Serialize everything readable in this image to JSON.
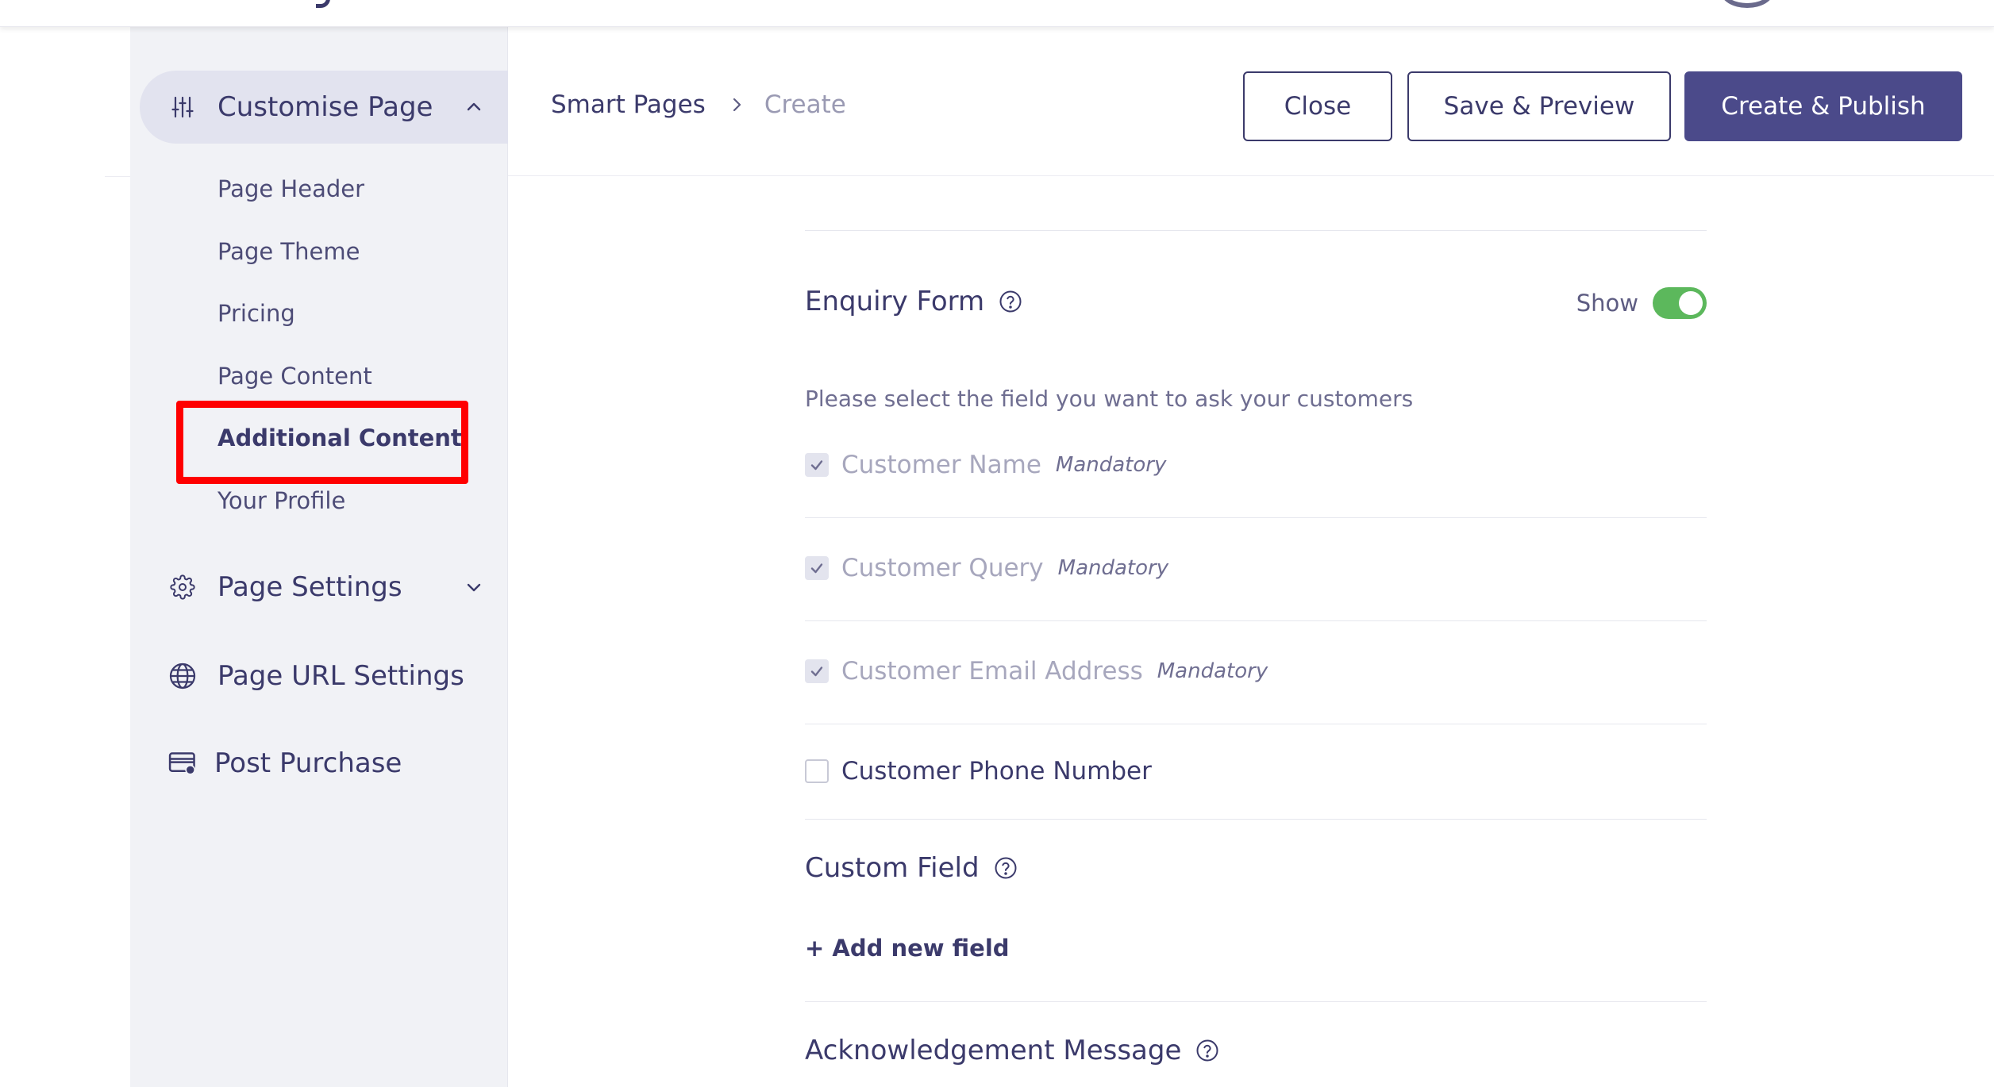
{
  "sidebar": {
    "sections": [
      {
        "label": "Customise Page",
        "icon": "sliders-icon",
        "expanded": true
      },
      {
        "label": "Page Settings",
        "icon": "gear-icon",
        "expanded": false
      },
      {
        "label": "Page URL Settings",
        "icon": "globe-icon"
      },
      {
        "label": "Post Purchase",
        "icon": "card-icon"
      }
    ],
    "sub_items": [
      {
        "label": "Page Header"
      },
      {
        "label": "Page Theme"
      },
      {
        "label": "Pricing"
      },
      {
        "label": "Page Content"
      },
      {
        "label": "Additional Content",
        "selected": true
      },
      {
        "label": "Your Profile"
      }
    ]
  },
  "header": {
    "breadcrumb": {
      "root": "Smart Pages",
      "current": "Create"
    },
    "buttons": {
      "close": "Close",
      "save_preview": "Save & Preview",
      "create_publish": "Create & Publish"
    }
  },
  "enquiry_form": {
    "title": "Enquiry Form",
    "toggle_label": "Show",
    "toggle_on": true,
    "hint": "Please select the field you want to ask your customers",
    "fields": [
      {
        "label": "Customer Name",
        "checked": true,
        "badge": "Mandatory"
      },
      {
        "label": "Customer Query",
        "checked": true,
        "badge": "Mandatory"
      },
      {
        "label": "Customer Email Address",
        "checked": true,
        "badge": "Mandatory"
      },
      {
        "label": "Customer Phone Number",
        "checked": false,
        "badge": ""
      }
    ]
  },
  "custom_field": {
    "title": "Custom Field",
    "add_label": "+ Add new field"
  },
  "acknowledgement": {
    "title": "Acknowledgement Message"
  },
  "colors": {
    "primary": "#4b4a8a",
    "text": "#3b3a6b",
    "sidebar_bg": "#f1f2f6",
    "toggle_on": "#5cb85c",
    "highlight": "#ff0000"
  }
}
